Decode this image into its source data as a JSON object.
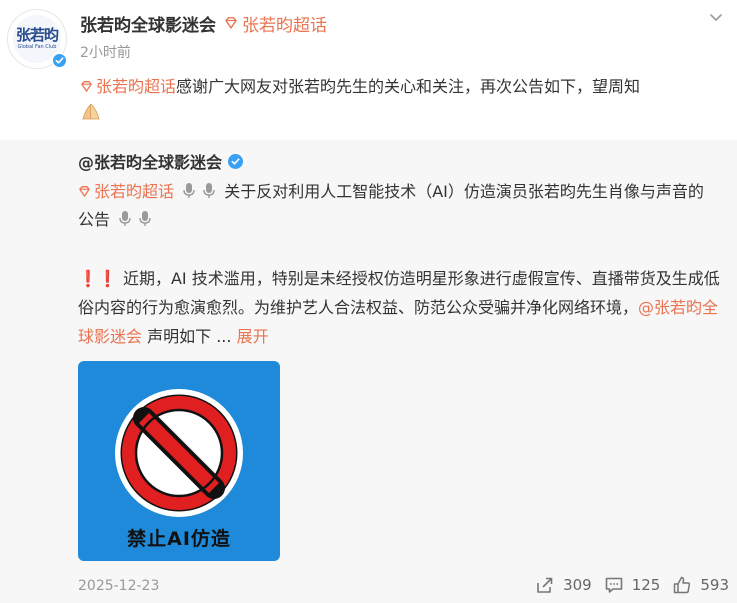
{
  "post": {
    "author": "张若昀全球影迷会",
    "topic": "张若昀超话",
    "time": "2小时前",
    "text_link": "张若昀超话",
    "text": "感谢广大网友对张若昀先生的关心和关注，再次公告如下，望周知"
  },
  "avatar": {
    "chars": "张若昀",
    "sub": "Global Fan Club"
  },
  "repost": {
    "author": "@张若昀全球影迷会",
    "title_link": "张若昀超话",
    "title_text": "关于反对利用人工智能技术（AI）仿造演员张若昀先生肖像与声音的公告",
    "body_excl": "❗❗",
    "body_text": "近期，AI 技术滥用，特别是未经授权仿造明星形象进行虚假宣传、直播带货及生成低俗内容的行为愈演愈烈。为维护艺人合法权益、防范公众受骗并净化网络环境，",
    "body_mention": "@张若昀全球影迷会",
    "body_tail": "声明如下 ...",
    "expand": "展开",
    "image_caption": "禁止AI仿造",
    "date": "2025-12-23",
    "reposts": "309",
    "comments": "125",
    "likes": "593"
  },
  "colors": {
    "accent": "#eb7350",
    "verified": "#3aa0f2",
    "image_bg": "#1f8ad9",
    "prohibit_red": "#e02020"
  },
  "icons": [
    "gem-icon",
    "chevron-down-icon",
    "verified-icon",
    "pray-icon",
    "mic-icon",
    "repost-icon",
    "comment-icon",
    "like-icon"
  ]
}
